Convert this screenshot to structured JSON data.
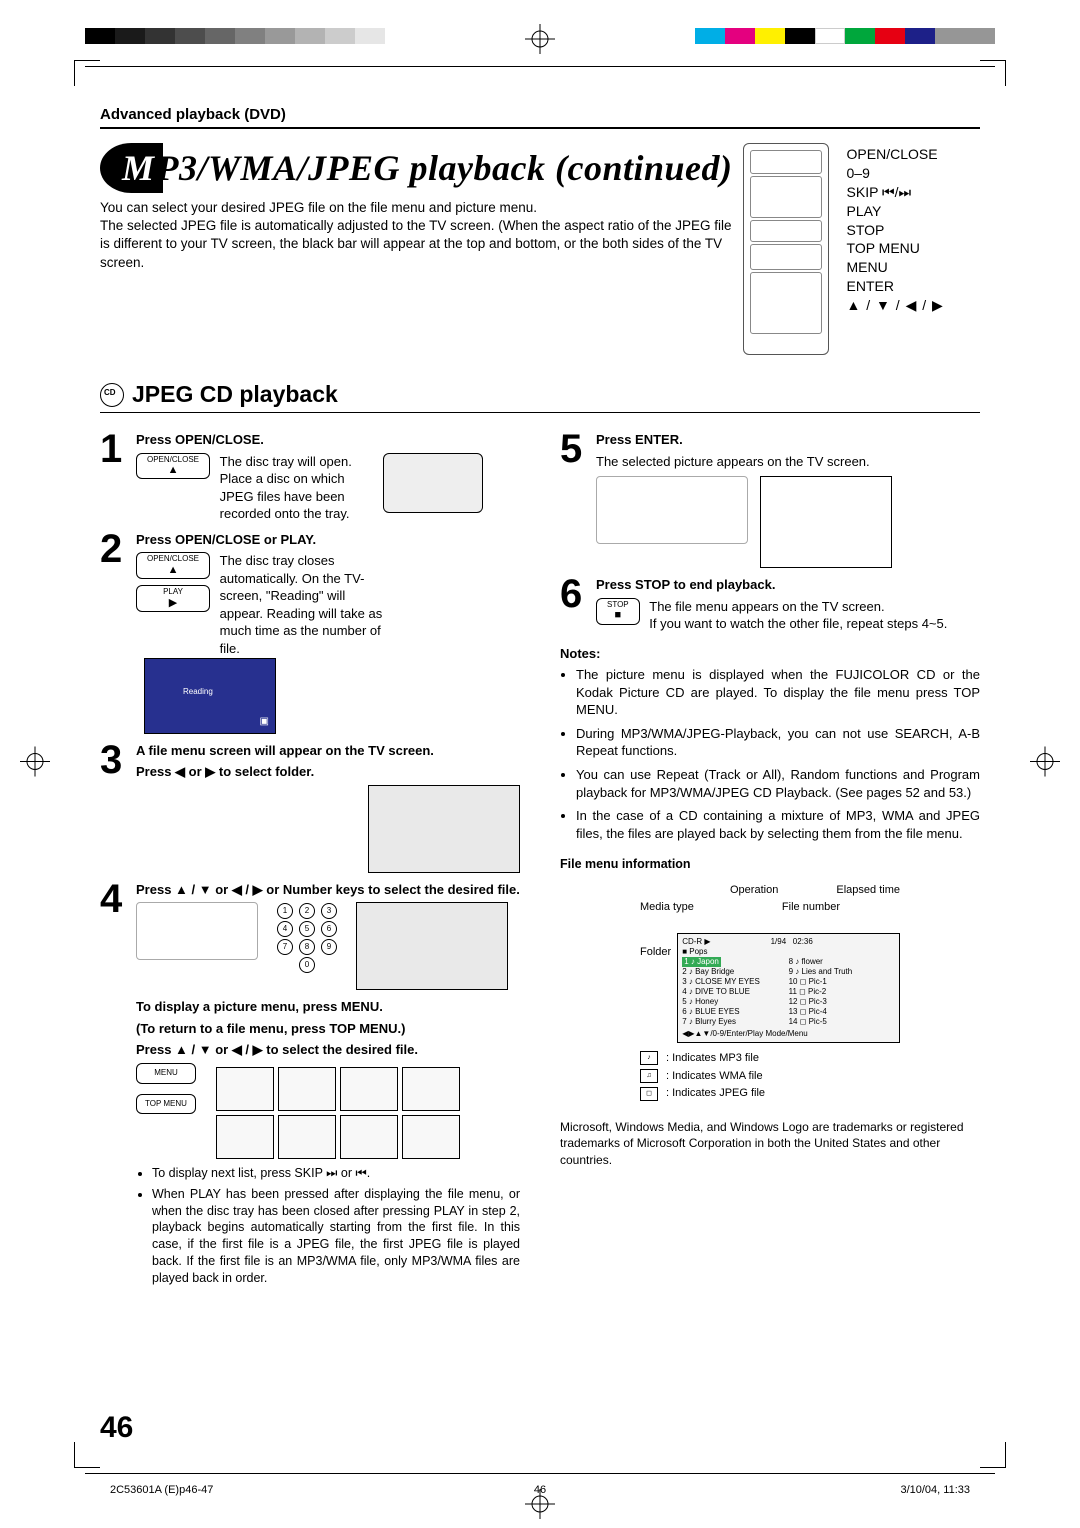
{
  "header": {
    "section": "Advanced playback (DVD)"
  },
  "hero": {
    "title_lead": "M",
    "title_rest": "P3/WMA/JPEG playback (continued)",
    "intro": "You can select your desired JPEG file on the file menu and picture menu.\nThe selected JPEG file is automatically adjusted to the TV screen. (When the aspect ratio of the JPEG file is different to your TV screen, the black bar will appear at the top and bottom, or the both sides of the TV screen."
  },
  "remote_labels": {
    "l1": "OPEN/CLOSE",
    "l2": "0–9",
    "l3": "SKIP ⏮/⏭",
    "l4": "PLAY",
    "l5": "STOP",
    "l6": "TOP MENU",
    "l7": "MENU",
    "l8": "ENTER",
    "l9": "▲ / ▼ / ◀ / ▶"
  },
  "h2": "JPEG CD playback",
  "steps": {
    "s1": {
      "hd": "Press OPEN/CLOSE.",
      "btn": "OPEN/CLOSE",
      "btn_sym": "▲",
      "body": "The disc tray will open. Place a disc on which JPEG files have been recorded onto the tray."
    },
    "s2": {
      "hd": "Press OPEN/CLOSE or PLAY.",
      "btn1": "OPEN/CLOSE",
      "btn1_sym": "▲",
      "btn2": "PLAY",
      "btn2_sym": "▶",
      "body": "The disc tray closes automatically. On the TV-screen, \"Reading\" will appear. Reading will take as much time as the number of file.",
      "tv_text": "Reading"
    },
    "s3": {
      "hd1": "A file menu screen will appear on the TV screen.",
      "hd2": "Press ◀ or ▶ to select folder."
    },
    "s4": {
      "hd": "Press ▲ / ▼ or ◀ / ▶ or Number keys to select the desired file.",
      "sub1": "To display a picture menu, press MENU.",
      "sub2": "(To return to a file menu, press TOP MENU.)",
      "sub3": "Press ▲ / ▼ or ◀ / ▶ to select the desired file.",
      "btn1": "MENU",
      "btn2": "TOP MENU",
      "bul1": "To display next list, press SKIP ⏭ or ⏮.",
      "bul2": "When PLAY has been pressed after displaying the file menu, or when the disc tray has been closed after pressing PLAY in step 2, playback begins automatically starting from the first file. In this case, if the first file is a JPEG file, the first JPEG file is played back. If the first file is an MP3/WMA file, only MP3/WMA files are played back in order."
    },
    "s5": {
      "hd": "Press ENTER.",
      "body": "The selected picture appears on the TV screen."
    },
    "s6": {
      "hd": "Press STOP to end playback.",
      "btn": "STOP",
      "btn_sym": "■",
      "body": "The file menu appears on the TV screen.\nIf you want to watch the other file, repeat steps 4~5."
    }
  },
  "notes": {
    "hd": "Notes:",
    "n1": "The picture menu is displayed when the FUJICOLOR CD or the Kodak Picture CD are played. To display the file menu press TOP MENU.",
    "n2": "During MP3/WMA/JPEG-Playback, you can not use SEARCH, A-B Repeat functions.",
    "n3": "You can use Repeat (Track or All), Random functions and Program playback for MP3/WMA/JPEG CD Playback. (See pages 52 and 53.)",
    "n4": "In the case of a CD containing a mixture of MP3, WMA and JPEG files, the files are played back by selecting them from the file menu."
  },
  "fmi": {
    "hd": "File menu information",
    "lbl_media": "Media type",
    "lbl_op": "Operation",
    "lbl_fileno": "File number",
    "lbl_elapsed": "Elapsed time",
    "lbl_folder": "Folder",
    "panel": {
      "header": "CD-R ▶                           1/94   02:36",
      "folder": "■ Pops",
      "rows_left": [
        "1 ♪ Japon",
        "2 ♪ Bay Bridge",
        "3 ♪ CLOSE MY EYES",
        "4 ♪ DIVE TO BLUE",
        "5 ♪ Honey",
        "6 ♪ BLUE EYES",
        "7 ♪ Blurry Eyes"
      ],
      "rows_right": [
        "8 ♪ flower",
        "9 ♪ Lies and Truth",
        "10 ◻ Pic-1",
        "11 ◻ Pic-2",
        "12 ◻ Pic-3",
        "13 ◻ Pic-4",
        "14 ◻ Pic-5"
      ],
      "footer": "◀▶▲▼/0-9/Enter/Play Mode/Menu"
    },
    "legend1": ": Indicates MP3 file",
    "legend2": ": Indicates WMA file",
    "legend3": ": Indicates JPEG file",
    "ic1": "♪",
    "ic2": "♫",
    "ic3": "◻"
  },
  "trademark": "Microsoft, Windows Media, and Windows Logo are trademarks or registered trademarks of Microsoft Corporation in both the United States and other countries.",
  "pagenum": "46",
  "footer": {
    "left": "2C53601A (E)p46-47",
    "center": "46",
    "right": "3/10/04, 11:33"
  },
  "printer_colors": {
    "left": [
      "#000",
      "#000",
      "#000",
      "#000",
      "#000",
      "#000",
      "#000",
      "#000",
      "#000",
      "#000"
    ],
    "right": [
      "#00aee6",
      "#e4007f",
      "#fff000",
      "#000000",
      "#ffffff",
      "#00a73c",
      "#e60012",
      "#1d2088",
      "#969696",
      "#969696"
    ]
  }
}
